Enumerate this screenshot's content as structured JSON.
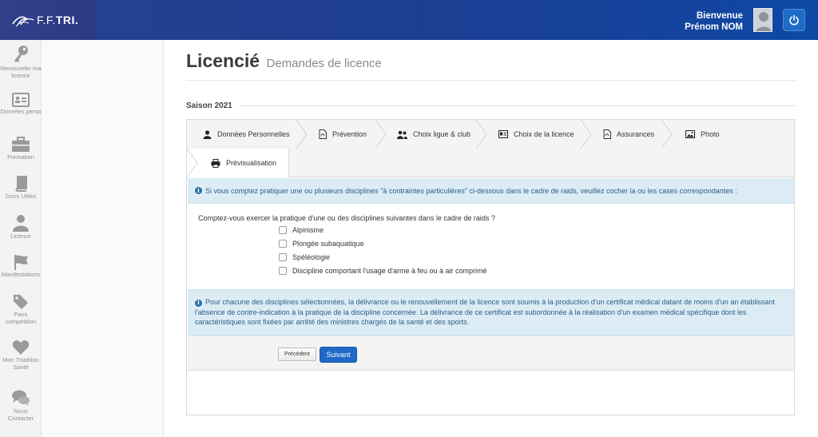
{
  "header": {
    "brand": {
      "prefix": "F.F.",
      "name": "TRI."
    },
    "welcome_label": "Bienvenue",
    "user_name": "Prénom NOM",
    "logout_icon": "power-icon"
  },
  "sidebar": {
    "items": [
      {
        "label": "Renouveler ma licence",
        "icon": "key-icon"
      },
      {
        "label": "Données perso",
        "icon": "id-card-icon"
      },
      {
        "label": "Formation",
        "icon": "briefcase-icon"
      },
      {
        "label": "Docs Utiles",
        "icon": "book-icon"
      },
      {
        "label": "Licence",
        "icon": "user-icon"
      },
      {
        "label": "Manifestations",
        "icon": "flag-icon"
      },
      {
        "label": "Pass compétition",
        "icon": "tag-icon"
      },
      {
        "label": "Mon Triathlon Santé",
        "icon": "heart-icon"
      },
      {
        "label": "Nous Contacter",
        "icon": "chat-icon"
      }
    ]
  },
  "page": {
    "title": "Licencié",
    "subtitle": "Demandes de licence",
    "season": "Saison 2021"
  },
  "tabs": [
    {
      "label": "Données Personnelles",
      "icon": "user-icon"
    },
    {
      "label": "Prévention",
      "icon": "pdf-icon"
    },
    {
      "label": "Choix ligue & club",
      "icon": "users-icon"
    },
    {
      "label": "Choix de la licence",
      "icon": "id-card-icon"
    },
    {
      "label": "Assurances",
      "icon": "pdf-icon"
    },
    {
      "label": "Photo",
      "icon": "image-icon"
    },
    {
      "label": "Prévisualisation",
      "icon": "printer-icon"
    }
  ],
  "form": {
    "info_top": "Si vous comptez pratiquer une ou plusieurs disciplines \"à contraintes particulières\" ci-dessous dans le cadre de raids, veuillez cocher la ou les cases correspondantes :",
    "question": "Comptez-vous exercer la pratique d'une ou des disciplines suivantes dans le cadre de raids ?",
    "options": [
      {
        "label": "Alpinisme",
        "checked": false
      },
      {
        "label": "Plongée subaquatique",
        "checked": false
      },
      {
        "label": "Spéléologie",
        "checked": false
      },
      {
        "label": "Discipline comportant l'usage d'arme à feu ou à air comprimé",
        "checked": false
      }
    ],
    "info_bottom": "Pour chacune des disciplines sélectionnées, la délivrance ou le renouvellement de la licence sont soumis à la production d'un certificat médical datant de moins d'un an établissant l'absence de contre-indication à la pratique de la discipline concernée. La délivrance de ce certificat est subordonnée à la réalisation d'un examen médical spécifique dont les caractéristiques sont fixées par arrêté des ministres chargés de la santé et des sports.",
    "prev_label": "Précédent",
    "next_label": "Suivant"
  },
  "colors": {
    "header_blue": "#1d3e92",
    "accent": "#1f6ac8",
    "info_bg": "#dcecf5",
    "info_text": "#2a5d86"
  }
}
